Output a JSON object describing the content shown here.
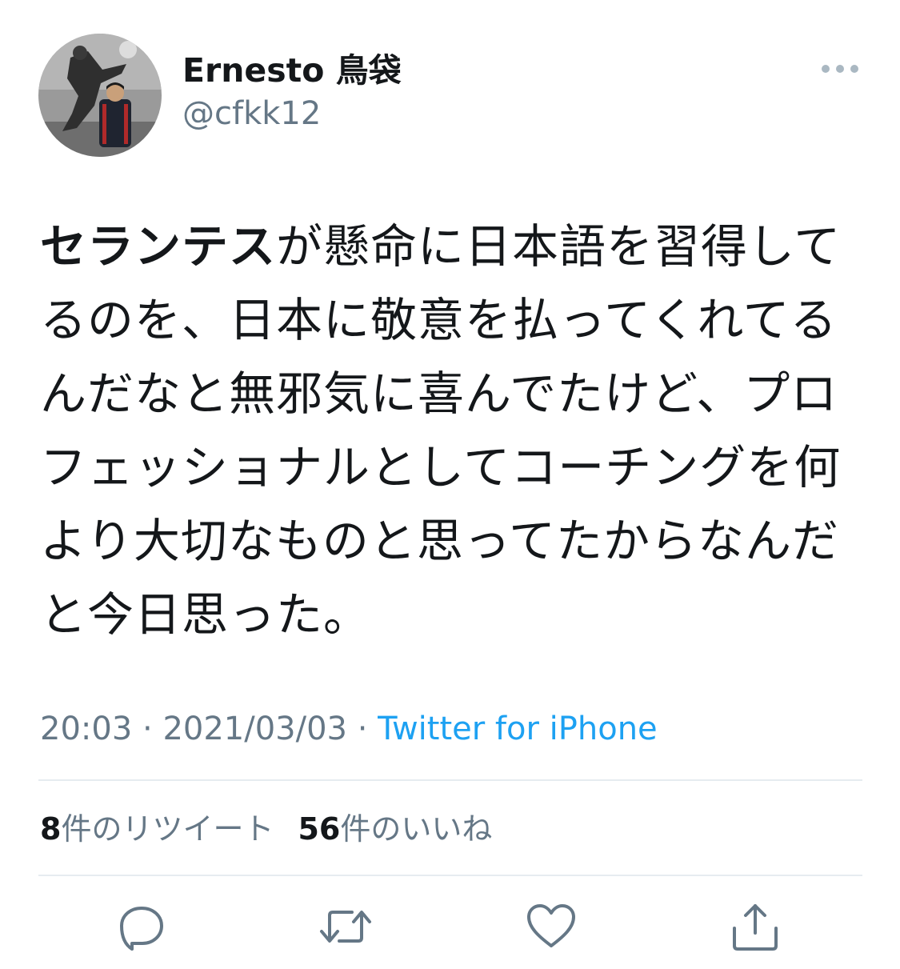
{
  "author": {
    "display_name": "Ernesto 鳥袋",
    "handle": "@cfkk12",
    "avatar_icon": "avatar-photo"
  },
  "tweet": {
    "bold_text": "セランテス",
    "text": "が懸命に日本語を習得してるのを、日本に敬意を払ってくれてるんだなと無邪気に喜んでたけど、プロフェッショナルとしてコーチングを何より大切なものと思ってたからなんだと今日思った。"
  },
  "meta": {
    "time": "20:03",
    "separator1": " · ",
    "date": "2021/03/03",
    "separator2": " · ",
    "source": "Twitter for iPhone"
  },
  "stats": {
    "retweet_count": "8",
    "retweet_label": "件のリツイート",
    "like_count": "56",
    "like_label": "件のいいね"
  },
  "actions": [
    "reply-icon",
    "retweet-icon",
    "like-icon",
    "share-icon"
  ],
  "colors": {
    "text": "#14171a",
    "secondary": "#657786",
    "link": "#1da1f2",
    "divider": "#e6ecf0"
  }
}
